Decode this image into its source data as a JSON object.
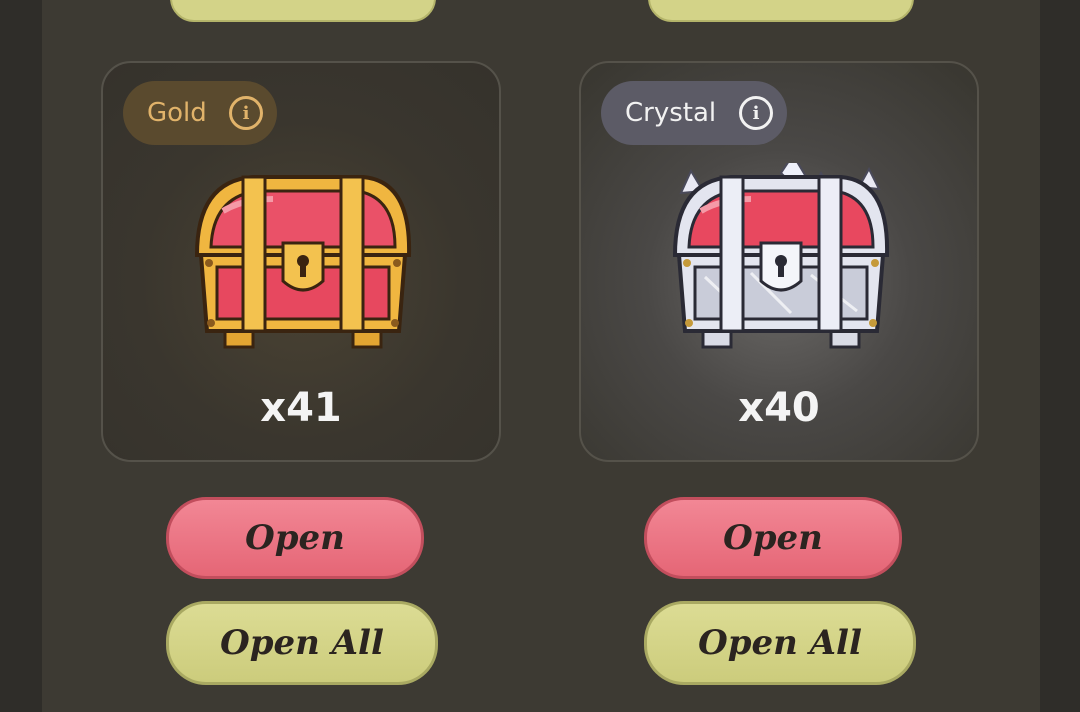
{
  "cards": [
    {
      "tag_label": "Gold",
      "count": "x41",
      "open_label": "Open",
      "open_all_label": "Open All",
      "chest_icon": "gold-chest",
      "tag_color": "#e1b36a"
    },
    {
      "tag_label": "Crystal",
      "count": "x40",
      "open_label": "Open",
      "open_all_label": "Open All",
      "chest_icon": "crystal-chest",
      "tag_color": "#f2f2f2"
    }
  ],
  "colors": {
    "open_button": "#e56676",
    "open_all_button": "#d3d388",
    "background": "#3d3a33"
  }
}
